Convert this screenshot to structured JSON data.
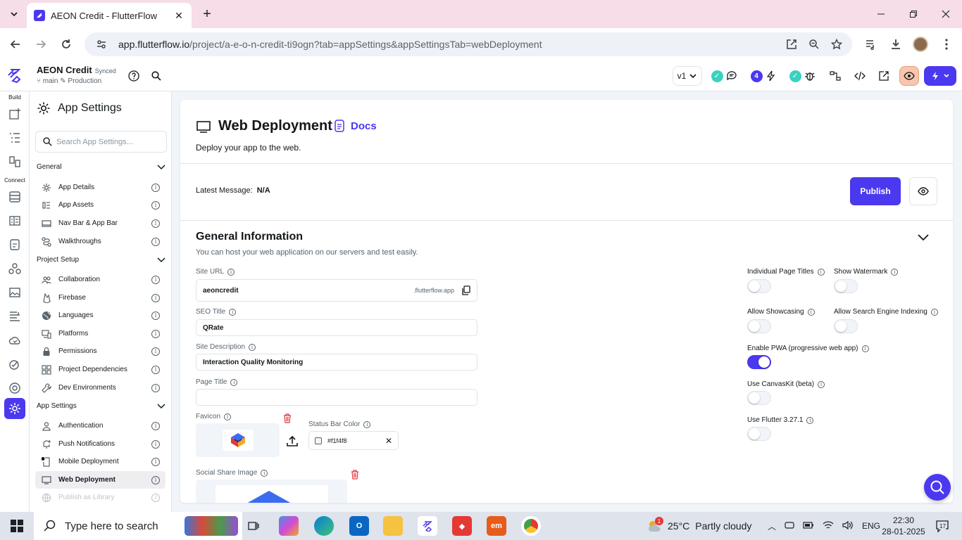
{
  "browser": {
    "tab_title": "AEON Credit - FlutterFlow",
    "url_host": "app.flutterflow.io",
    "url_path": "/project/a-e-o-n-credit-ti9ogn?tab=appSettings&appSettingsTab=webDeployment"
  },
  "header": {
    "project_name": "AEON Credit",
    "sync_status": "Synced",
    "branch": "main",
    "environment": "Production",
    "version": "v1",
    "issues_count": "4"
  },
  "rail": {
    "build_label": "Build",
    "connect_label": "Connect"
  },
  "panel": {
    "title": "App Settings",
    "search_placeholder": "Search App Settings...",
    "sections": [
      {
        "title": "General",
        "items": [
          "App Details",
          "App Assets",
          "Nav Bar & App Bar",
          "Walkthroughs"
        ]
      },
      {
        "title": "Project Setup",
        "items": [
          "Collaboration",
          "Firebase",
          "Languages",
          "Platforms",
          "Permissions",
          "Project Dependencies",
          "Dev Environments"
        ]
      },
      {
        "title": "App Settings",
        "items": [
          "Authentication",
          "Push Notifications",
          "Mobile Deployment",
          "Web Deployment",
          "Publish as Library"
        ]
      }
    ]
  },
  "main": {
    "title": "Web Deployment",
    "docs_label": "Docs",
    "subtitle": "Deploy your app to the web.",
    "latest_label": "Latest Message:",
    "latest_value": "N/A",
    "publish_label": "Publish",
    "general": {
      "title": "General Information",
      "subtitle": "You can host your web application on our servers and test easily.",
      "site_url_label": "Site URL",
      "site_url_value": "aeoncredit",
      "site_url_suffix": ".flutterflow.app",
      "seo_title_label": "SEO Title",
      "seo_title_value": "QRate",
      "site_desc_label": "Site Description",
      "site_desc_value": "Interaction Quality Monitoring",
      "page_title_label": "Page Title",
      "page_title_value": "",
      "favicon_label": "Favicon",
      "status_bar_label": "Status Bar Color",
      "status_bar_value": "#f1f4f8",
      "social_share_label": "Social Share Image"
    },
    "toggles": [
      {
        "label": "Individual Page Titles",
        "on": false
      },
      {
        "label": "Show Watermark",
        "on": false
      },
      {
        "label": "Allow Showcasing",
        "on": false
      },
      {
        "label": "Allow Search Engine Indexing",
        "on": false
      },
      {
        "label": "Enable PWA (progressive web app)",
        "on": true
      },
      {
        "label": "Use CanvasKit (beta)",
        "on": false
      },
      {
        "label": "Use Flutter 3.27.1",
        "on": false
      }
    ]
  },
  "taskbar": {
    "search_placeholder": "Type here to search",
    "temperature": "25°C",
    "weather": "Partly cloudy",
    "weather_badge": "1",
    "language": "ENG",
    "time": "22:30",
    "date": "28-01-2025",
    "notifications": "17"
  },
  "colors": {
    "accent": "#4b39ef",
    "success": "#39d2c0",
    "danger": "#e0383e",
    "tabstrip": "#f6dde8"
  }
}
